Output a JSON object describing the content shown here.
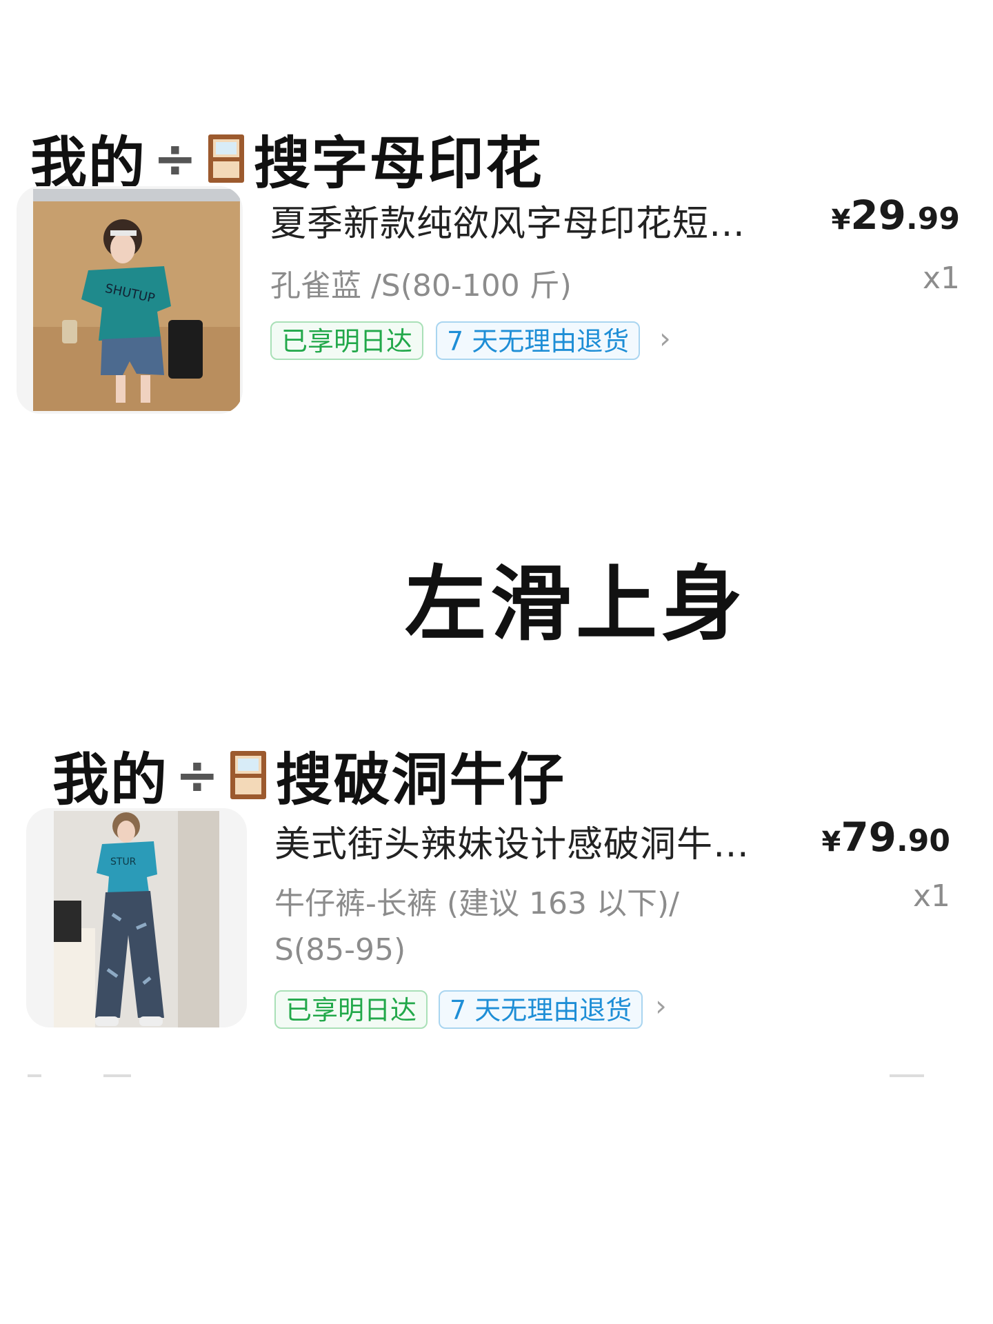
{
  "section1": {
    "heading_prefix": "我的",
    "heading_divide": "÷",
    "heading_icon": "window-icon",
    "heading_suffix": "搜字母印花",
    "product": {
      "title": "夏季新款纯欲风字母印花短…",
      "spec": "孔雀蓝 /S(80-100 斤)",
      "price_currency": "¥",
      "price_int": "29",
      "price_dec": ".99",
      "qty": "x1",
      "tag_delivery": "已享明日达",
      "tag_return": "7 天无理由退货",
      "chevron": "›"
    }
  },
  "center_title": "左滑上身",
  "section2": {
    "heading_prefix": "我的",
    "heading_divide": "÷",
    "heading_icon": "window-icon",
    "heading_suffix": "搜破洞牛仔",
    "product": {
      "title": "美式街头辣妹设计感破洞牛…",
      "spec_line1": "牛仔裤-长裤 (建议 163 以下)/",
      "spec_line2": "S(85-95)",
      "price_currency": "¥",
      "price_int": "79",
      "price_dec": ".90",
      "qty": "x1",
      "tag_delivery": "已享明日达",
      "tag_return": "7 天无理由退货",
      "chevron": "›"
    }
  },
  "colors": {
    "tag_green": "#22a84a",
    "tag_blue": "#1e8ed6",
    "muted_text": "#8c8c8c",
    "window_frame": "#9c5a2e"
  }
}
